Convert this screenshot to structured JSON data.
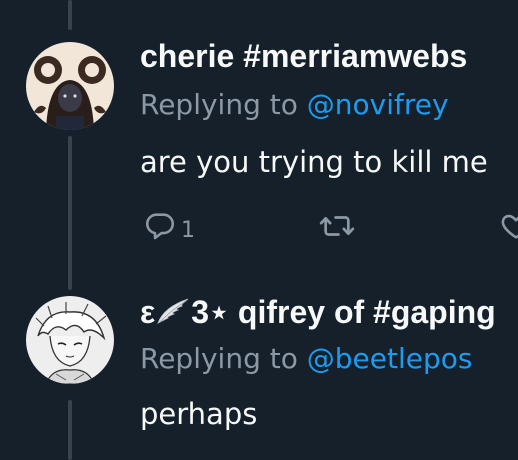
{
  "theme": {
    "background": "#15202b",
    "text_primary": "#f7f9f9",
    "text_secondary": "#8b98a5",
    "link": "#1d9bf0",
    "thread_line": "#38444d"
  },
  "tweets": [
    {
      "display_name": "cherie #merriamwebs",
      "reply_prefix": "Replying to ",
      "reply_handle": "@novifrey",
      "text": "are you trying to kill me",
      "actions": {
        "reply_icon": "comment-icon",
        "reply_count": "1",
        "retweet_icon": "retweet-icon",
        "like_icon": "heart-icon"
      }
    },
    {
      "display_name_prefix": "ε",
      "display_name_suffix": "3⋆ qifrey of #gaping",
      "display_name_icon": "wing-icon",
      "reply_prefix": "Replying to ",
      "reply_handle": "@beetlepos",
      "text": "perhaps"
    }
  ]
}
